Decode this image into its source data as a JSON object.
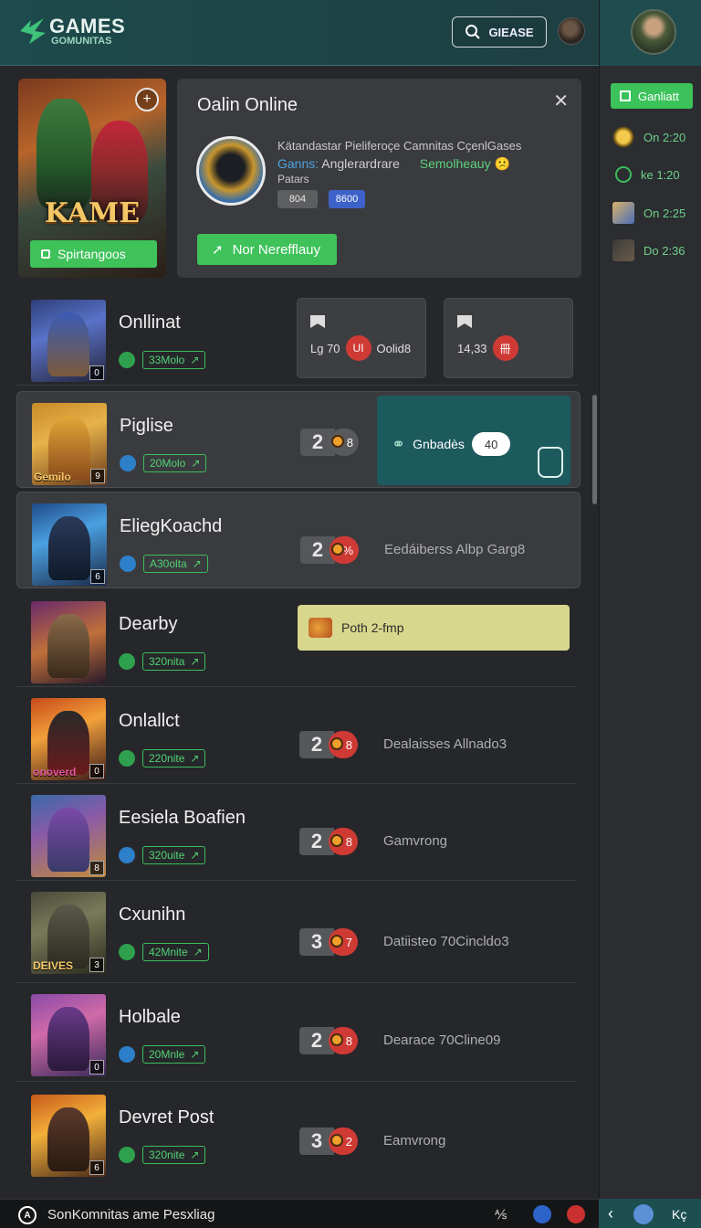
{
  "header": {
    "logo_title": "GAMES",
    "logo_sub": "GOMUNITAS",
    "search_label": "GIEASE"
  },
  "right_panel": {
    "button_label": "Ganliatt",
    "items": [
      {
        "icon": "coin-icon",
        "text": "On 2:20",
        "color": "#e3b33a"
      },
      {
        "icon": "refresh-icon",
        "text": "ke 1:20",
        "color": "#3cbd5c"
      },
      {
        "icon": "avatar-icon",
        "text": "On 2:25",
        "color": "#6a87c7"
      },
      {
        "icon": "avatar-icon",
        "text": "Do 2:36",
        "color": "#4a4a4a"
      }
    ]
  },
  "featured": {
    "card_title": "KAME",
    "card_button": "Spirtangoos",
    "title": "Oalin Online",
    "line1": "Kätandastar Pieliferoçe Camnitas CçenlGases",
    "line2_blue": "Ganns:",
    "line2": "Anglerardrare",
    "line2_green": "Semolheauy",
    "line2_emoji": "😕",
    "line3": "Patars",
    "tag1": "804",
    "tag2": "8600",
    "action_button": "Nor Nerefflauy"
  },
  "rows": [
    {
      "title": "Onllinat",
      "pill": "33Molo",
      "mini1": {
        "label": "Lg 70",
        "badge": "UI",
        "after": "Oolid8"
      },
      "mini2": {
        "label": "14,33",
        "badge": "冊"
      }
    },
    {
      "title": "Piglise",
      "pill": "20Molo",
      "score": "2",
      "score_badge": "8",
      "teal_label": "Gnbadès",
      "teal_value": "40",
      "thumb_caption": "Gemilo"
    },
    {
      "title": "EliegKoachd",
      "pill": "A30olta",
      "score": "2",
      "score_badge": "%",
      "desc": "Eedáiberss Albp Garg8"
    },
    {
      "title": "Dearby",
      "pill": "320nita",
      "yellow": "Poth 2-fmp"
    },
    {
      "title": "Onlallct",
      "pill": "220nite",
      "score": "2",
      "score_badge": "8",
      "desc": "Dealaisses Allnado3",
      "thumb_caption": "onoverd"
    },
    {
      "title": "Eesiela Boafien",
      "pill": "320uite",
      "score": "2",
      "score_badge": "8",
      "desc": "Gamvrong"
    },
    {
      "title": "Cxunihn",
      "pill": "42Mnite",
      "score": "3",
      "score_badge": "7",
      "desc": "Datiisteo 70Cincldo3",
      "thumb_caption": "DEIVES"
    },
    {
      "title": "Holbale",
      "pill": "20Mnle",
      "score": "2",
      "score_badge": "8",
      "desc": "Dearace 70Cline09"
    },
    {
      "title": "Devret Post",
      "pill": "320nite",
      "score": "3",
      "score_badge": "2",
      "desc": "Eamvrong"
    }
  ],
  "bottom": {
    "text": "SonKomnitas ame Pesxliag",
    "right_icon_text": "⅍",
    "corner_text": "Kç"
  }
}
